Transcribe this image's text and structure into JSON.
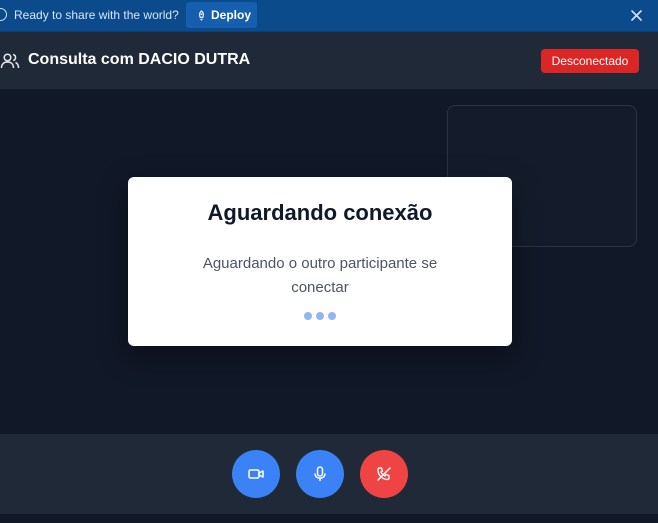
{
  "banner": {
    "text": "Ready to share with the world?",
    "deploy_label": "Deploy",
    "icons": [
      "info-icon",
      "rocket-icon",
      "close-icon"
    ]
  },
  "header": {
    "title": "Consulta com DACIO DUTRA",
    "status": "Desconectado",
    "status_color": "#dc2626",
    "icon": "users-icon"
  },
  "modal": {
    "title": "Aguardando conexão",
    "message": "Aguardando o outro participante se conectar",
    "loader": "three-dots"
  },
  "controls": {
    "buttons": [
      {
        "name": "camera",
        "icon": "video-camera-icon",
        "color": "#3b82f6"
      },
      {
        "name": "microphone",
        "icon": "microphone-icon",
        "color": "#3b82f6"
      },
      {
        "name": "hang-up",
        "icon": "phone-off-icon",
        "color": "#ef4444"
      }
    ]
  }
}
